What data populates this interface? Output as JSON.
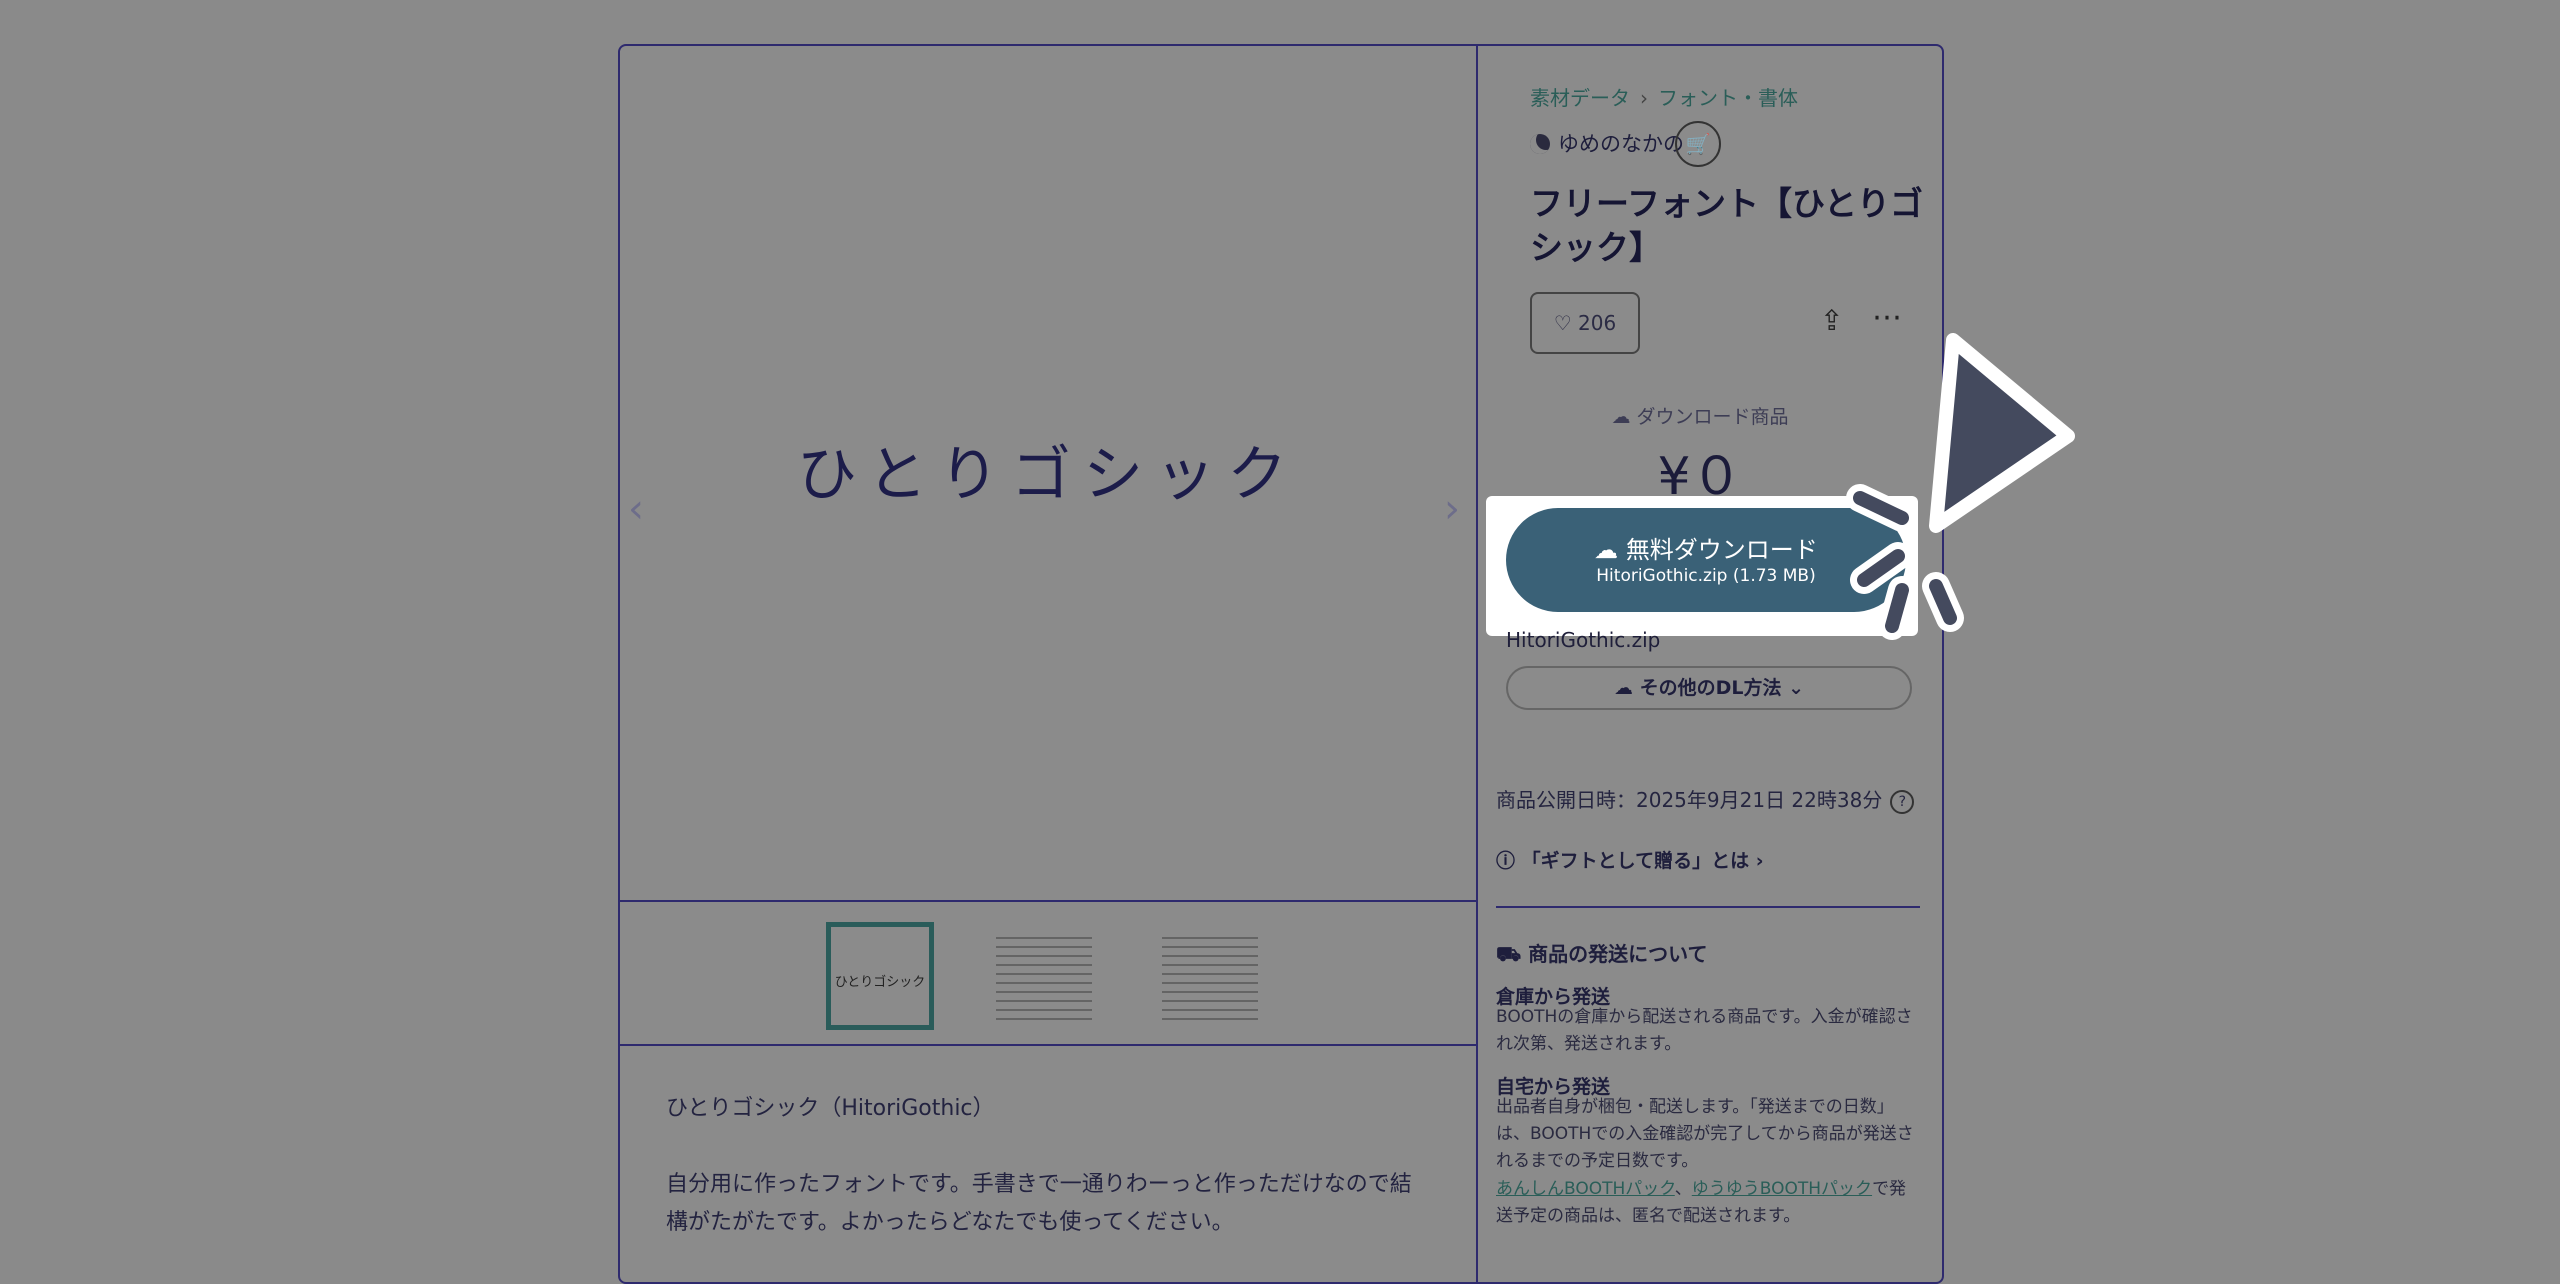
{
  "gallery": {
    "main_text": "ひとりゴシック",
    "prev_arrow": "‹",
    "next_arrow": "›",
    "thumb1_label": "ひとりゴシック"
  },
  "description": {
    "line1": "ひとりゴシック（HitoriGothic）",
    "line2": "自分用に作ったフォントです。手書きで一通りわーっと作っただけなので結",
    "line3": "構がたがたです。よかったらどなたでも使ってください。"
  },
  "breadcrumb": {
    "item1": "素材データ",
    "separator": "›",
    "item2": "フォント・書体"
  },
  "shop": {
    "name": "ゆめのなかの",
    "cart_icon": "cart-icon"
  },
  "product": {
    "title": "フリーフォント【ひとりゴシック】",
    "likes": "206",
    "dl_tag": "ダウンロード商品",
    "price": "¥０",
    "download_label": "無料ダウンロード",
    "download_file": "HitoriGothic.zip (1.73 MB)",
    "file_name": "HitoriGothic.zip",
    "other_dl": "その他のDL方法",
    "published": "商品公開日時：2025年9月21日 22時38分",
    "gift": "「ギフトとして贈る」とは",
    "gift_chevron": "›"
  },
  "shipping": {
    "heading": "商品の発送について",
    "warehouse_title": "倉庫から発送",
    "warehouse_body": "BOOTHの倉庫から配送される商品です。入金が確認され次第、発送されます。",
    "home_title": "自宅から発送",
    "home_body": "出品者自身が梱包・配送します。「発送までの日数」は、BOOTHでの入金確認が完了してから商品が発送されるまでの予定日数です。",
    "pack_link1": "あんしんBOOTHパック",
    "pack_sep": "、",
    "pack_link2": "ゆうゆうBOOTHパック",
    "pack_body": "で発送予定の商品は、匿名で配送されます。"
  },
  "colors": {
    "overlay": "#8a8a8a",
    "button": "#3a6177",
    "accent": "#2a5e58",
    "border": "#2e2a6e"
  }
}
